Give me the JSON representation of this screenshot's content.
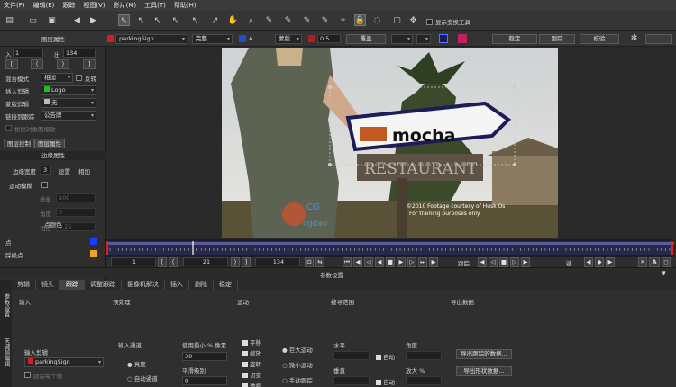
{
  "menu": [
    "文件(F)",
    "编辑(E)",
    "跟踪",
    "视图(V)",
    "影片(M)",
    "工具(T)",
    "帮助(H)"
  ],
  "toolbar": {
    "show_transform_tools": "显示变换工具"
  },
  "options_bar": {
    "layer_name": "parkingSign",
    "mode": "完整",
    "color_letter": "A",
    "matte_label": "蒙版",
    "opacity": "0.5",
    "overlay": "覆盖",
    "stabilize": "稳定",
    "track": "跟踪",
    "render_btn": "校验"
  },
  "left_panel": {
    "layer_props_header": "图层属性",
    "in_label": "入",
    "in_value": "1",
    "out_label": "出",
    "out_value": "134",
    "blend_mode_label": "混合模式",
    "blend_mode_value": "相加",
    "invert_label": "反转",
    "insert_clip_label": "插入剪辑",
    "insert_clip_value": "Logo",
    "matte_clip_label": "蒙版剪辑",
    "matte_clip_value": "无",
    "link_track_label": "链接到跟踪",
    "link_track_value": "公告牌",
    "disabled_option": "根据对象图缩放",
    "tab_layer_control": "图层控制",
    "tab_layer_props": "图层属性",
    "edge_props_header": "边缘属性",
    "edge_width_label": "边缘宽度",
    "edge_width_value": "3",
    "set_label": "设置",
    "add_label": "相加",
    "motion_blur_label": "运动模糊",
    "blur_quality_label": "质量",
    "blur_quality_value": "100",
    "blur_angle_label": "角度",
    "blur_angle_value": "0",
    "blur_phase_label": "相位",
    "blur_phase_value": "0.25",
    "point_color_header": "点颜色",
    "point_label": "点",
    "selected_point_label": "踩级点",
    "point_color": "#1e3cff",
    "selected_point_color": "#f0a030"
  },
  "viewer": {
    "logo_text": "mocha",
    "sign_text": "RESTAURANT",
    "watermark_brand": "CG",
    "watermark_site": "cgdao",
    "copyright_line1": "©2010 Footage courtesy of Husk Os",
    "copyright_line2": "For training purposes only"
  },
  "transport": {
    "frame_start": "1",
    "frame_current": "21",
    "frame_end": "134",
    "track_label": "跟踪",
    "key_label": "键"
  },
  "params": {
    "header": "参数设置",
    "tabs": [
      "剪辑",
      "镜头",
      "跟踪",
      "调整跟踪",
      "摄像机解决",
      "插入",
      "删除",
      "稳定"
    ],
    "active_tab": "跟踪",
    "vertical_tabs": [
      "参数设置",
      "关键帧编辑"
    ],
    "sections": [
      "输入",
      "预处理",
      "运动",
      "搜寻范围",
      "导出数据"
    ],
    "input_clip_label": "输入剪辑",
    "input_clip_value": "parkingSign",
    "frame_opt": "跟踪每个帧",
    "input_channel_label": "输入通道",
    "channel_luma": "亮度",
    "channel_auto": "自动通道",
    "min_pixels_label": "使用最小 % 像素",
    "min_pixels_value": "30",
    "smooth_label": "平滑级别",
    "smooth_value": "0",
    "motion_opts": [
      "平移",
      "缩放",
      "旋转",
      "切变",
      "透视"
    ],
    "motion_large": "巨大运动",
    "motion_small": "微小运动",
    "motion_manual": "手动跟踪",
    "horizontal_label": "水平",
    "vertical_label": "垂直",
    "auto_label": "自动",
    "angle_label": "角度",
    "zoom_label": "放大 %",
    "export_track_btn": "导出跟踪的数据...",
    "export_shape_btn": "导出形状数据..."
  }
}
